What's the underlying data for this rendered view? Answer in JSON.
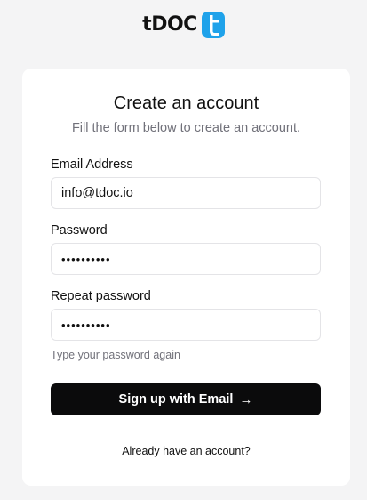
{
  "brand": {
    "name": "tDOC",
    "icon": "tdoc-logo-mark",
    "accent": "#1fa2ea"
  },
  "form": {
    "title": "Create an account",
    "subtitle": "Fill the form below to create an account.",
    "email": {
      "label": "Email Address",
      "value": "info@tdoc.io"
    },
    "password": {
      "label": "Password",
      "value": "••••••••••"
    },
    "repeat_password": {
      "label": "Repeat password",
      "value": "••••••••••",
      "hint": "Type your password again"
    },
    "submit": {
      "label": "Sign up with Email",
      "icon": "arrow-right-icon"
    },
    "signin_link": "Already have an account?"
  },
  "colors": {
    "page_background": "#f4f4f5",
    "card_background": "#ffffff",
    "button_background": "#0b0b0c",
    "muted_text": "#71717a",
    "border": "#e4e4e7"
  }
}
